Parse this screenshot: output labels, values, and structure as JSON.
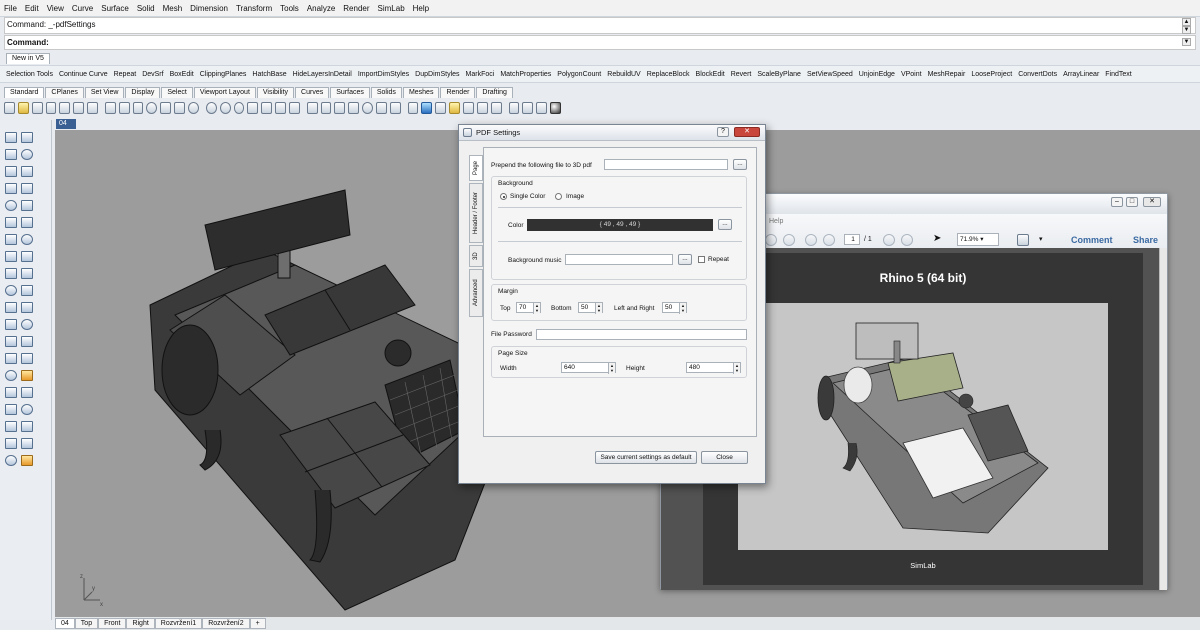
{
  "menu": [
    "File",
    "Edit",
    "View",
    "Curve",
    "Surface",
    "Solid",
    "Mesh",
    "Dimension",
    "Transform",
    "Tools",
    "Analyze",
    "Render",
    "SimLab",
    "Help"
  ],
  "command": {
    "history": "Command: _-pdfSettings",
    "prompt": "Command:"
  },
  "toolbar_tab": "New in V5",
  "command_buttons": [
    "Selection Tools",
    "Continue Curve",
    "Repeat",
    "DevSrf",
    "BoxEdit",
    "ClippingPlanes",
    "HatchBase",
    "HideLayersInDetail",
    "ImportDimStyles",
    "DupDimStyles",
    "MarkFoci",
    "MatchProperties",
    "PolygonCount",
    "RebuildUV",
    "ReplaceBlock",
    "BlockEdit",
    "Revert",
    "ScaleByPlane",
    "SetViewSpeed",
    "UnjoinEdge",
    "VPoint",
    "MeshRepair",
    "LooseProject",
    "ConvertDots",
    "ArrayLinear",
    "FindText"
  ],
  "tabs": [
    "Standard",
    "CPlanes",
    "Set View",
    "Display",
    "Select",
    "Viewport Layout",
    "Visibility",
    "Curves",
    "Surfaces",
    "Solids",
    "Meshes",
    "Render",
    "Drafting"
  ],
  "viewport": {
    "label": "04",
    "axis_x": "x",
    "axis_y": "y",
    "axis_z": "z"
  },
  "bottom_tabs": [
    "04",
    "Top",
    "Front",
    "Right",
    "Rozvržení1",
    "Rozvržení2",
    "+"
  ],
  "dialog": {
    "title": "PDF Settings",
    "help": "?",
    "close": "✕",
    "side_tabs": [
      "Page",
      "Header / Footer",
      "3D",
      "Advanced"
    ],
    "prepend_label": "Prepend the following file to 3D pdf",
    "browse": "...",
    "background_group": "Background",
    "single_color": "Single Color",
    "image": "Image",
    "color_label": "Color",
    "color_value": "{ 49 , 49 , 49 }",
    "color_hex": "#313131",
    "music_label": "Background music",
    "repeat_label": "Repeat",
    "margin_group": "Margin",
    "top_label": "Top",
    "top_value": "70",
    "bottom_label": "Bottom",
    "bottom_value": "50",
    "lr_label": "Left and Right",
    "lr_value": "50",
    "password_label": "File Password",
    "page_size_group": "Page Size",
    "width_label": "Width",
    "width_value": "640",
    "height_label": "Height",
    "height_value": "480",
    "save_button": "Save current settings as default",
    "close_button": "Close"
  },
  "acrobat": {
    "menu_help": "Help",
    "page_current": "1",
    "page_total": "/ 1",
    "zoom": "71.9%",
    "comment": "Comment",
    "share": "Share",
    "page_title": "Rhino 5 (64 bit)",
    "page_footer": "SimLab"
  }
}
